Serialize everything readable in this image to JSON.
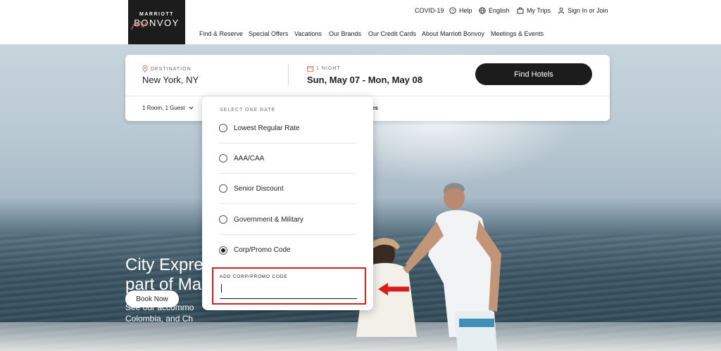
{
  "logo": {
    "line1": "MARRIOTT",
    "line2": "BONVOY"
  },
  "utility_nav": [
    {
      "label": "COVID-19",
      "icon": ""
    },
    {
      "label": "Help",
      "icon": "help-circle-icon"
    },
    {
      "label": "English",
      "icon": "globe-icon"
    },
    {
      "label": "My Trips",
      "icon": "suitcase-icon"
    },
    {
      "label": "Sign In or Join",
      "icon": "user-icon"
    }
  ],
  "main_nav": [
    "Find & Reserve",
    "Special Offers",
    "Vacations",
    "Our Brands",
    "Our Credit Cards",
    "About Marriott Bonvoy",
    "Meetings & Events"
  ],
  "search": {
    "destination_label": "DESTINATION",
    "destination_value": "New York, NY",
    "dates_label": "1 NIGHT",
    "dates_value": "Sun, May 07 - Mon, May 08",
    "find_button": "Find Hotels",
    "rooms_guests": "1 Room, 1 Guest",
    "partial_text": "es"
  },
  "rate_dropdown": {
    "title": "SELECT ONE RATE",
    "options": [
      {
        "label": "Lowest Regular Rate",
        "selected": false
      },
      {
        "label": "AAA/CAA",
        "selected": false
      },
      {
        "label": "Senior Discount",
        "selected": false
      },
      {
        "label": "Government & Military",
        "selected": false
      },
      {
        "label": "Corp/Promo Code",
        "selected": true
      }
    ],
    "promo_label": "ADD CORP/PROMO CODE",
    "promo_value": ""
  },
  "hero": {
    "title_line1": "City Expre",
    "title_line2": "part of Ma",
    "sub_line1": "See our accommo",
    "sub_line2": "Colombia, and Ch",
    "cta": "Book Now"
  },
  "colors": {
    "brand_dark": "#1c1c1c",
    "highlight_red": "#d81f1f",
    "accent_coral": "#e0705a"
  }
}
